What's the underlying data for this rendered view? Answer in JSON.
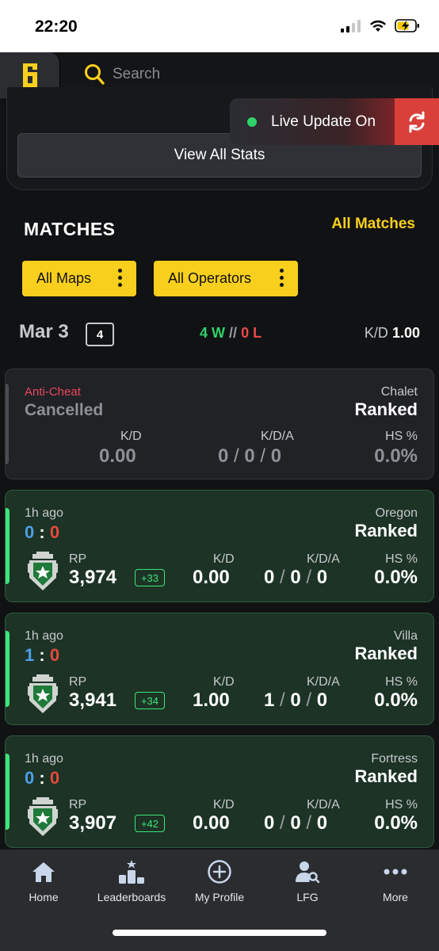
{
  "status_bar": {
    "time": "22:20"
  },
  "search": {
    "placeholder": "Search"
  },
  "live_update": {
    "label": "Live Update On"
  },
  "stats": {
    "view_all_label": "View All Stats"
  },
  "matches": {
    "title": "MATCHES",
    "all_matches_label": "All Matches",
    "filters": {
      "maps": "All Maps",
      "operators": "All Operators"
    }
  },
  "day": {
    "date": "Mar 3",
    "count": "4",
    "wins": "4 W",
    "separator": "//",
    "losses": "0 L",
    "kd_label": "K/D",
    "kd_value": "1.00"
  },
  "labels": {
    "kd": "K/D",
    "kda": "K/D/A",
    "hs": "HS %",
    "rp": "RP"
  },
  "cancelled_match": {
    "status_top": "Anti-Cheat",
    "status": "Cancelled",
    "map": "Chalet",
    "mode": "Ranked",
    "kd": "0.00",
    "k": "0",
    "d": "0",
    "a": "0",
    "hs": "0.0%"
  },
  "match_list": [
    {
      "ago": "1h ago",
      "score_a": "0",
      "score_b": "0",
      "map": "Oregon",
      "mode": "Ranked",
      "rp": "3,974",
      "rp_delta": "+33",
      "kd": "0.00",
      "k": "0",
      "d": "0",
      "a": "0",
      "hs": "0.0%"
    },
    {
      "ago": "1h ago",
      "score_a": "1",
      "score_b": "0",
      "map": "Villa",
      "mode": "Ranked",
      "rp": "3,941",
      "rp_delta": "+34",
      "kd": "1.00",
      "k": "1",
      "d": "0",
      "a": "0",
      "hs": "0.0%"
    },
    {
      "ago": "1h ago",
      "score_a": "0",
      "score_b": "0",
      "map": "Fortress",
      "mode": "Ranked",
      "rp": "3,907",
      "rp_delta": "+42",
      "kd": "0.00",
      "k": "0",
      "d": "0",
      "a": "0",
      "hs": "0.0%"
    }
  ],
  "bottom_nav": {
    "home": "Home",
    "leaderboards": "Leaderboards",
    "my_profile": "My Profile",
    "lfg": "LFG",
    "more": "More"
  },
  "colors": {
    "accent": "#f8cf1d",
    "win": "#2fd36a",
    "loss": "#e94a4a",
    "live": "#d9403a"
  }
}
